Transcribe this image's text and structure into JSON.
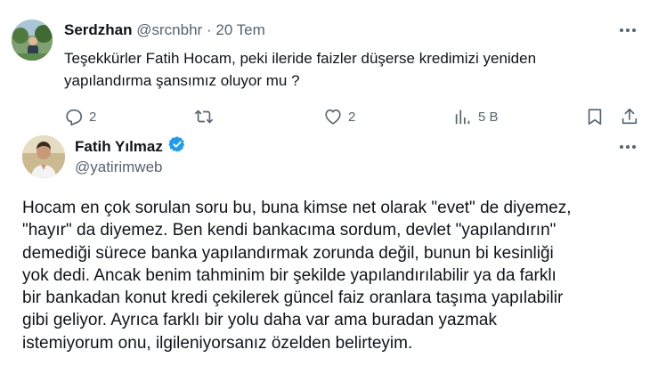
{
  "reply_tweet": {
    "author_name": "Serdzhan",
    "handle": "@srcnbhr",
    "separator": "·",
    "date": "20 Tem",
    "text_lines": [
      "Teşekkürler Fatih Hocam, peki ileride faizler düşerse kredimizi yeniden",
      "yapılandırma şansımız oluyor mu ?"
    ],
    "actions": {
      "reply_count": "2",
      "retweet_count": "",
      "like_count": "2",
      "views_count": "5 B"
    }
  },
  "main_tweet": {
    "author_name": "Fatih Yılmaz",
    "handle": "@yatirimweb",
    "verified": true,
    "text_lines": [
      "Hocam en çok sorulan soru bu, buna kimse net olarak \"evet\" de diyemez,",
      "\"hayır\" da diyemez. Ben kendi bankacıma sordum, devlet \"yapılandırın\"",
      "demediği sürece banka yapılandırmak zorunda değil, bunun bi kesinliği",
      "yok dedi. Ancak benim tahminim bir şekilde yapılandırılabilir ya da farklı",
      "bir bankadan konut kredi çekilerek güncel faiz oranlara taşıma yapılabilir",
      "gibi geliyor. Ayrıca farklı bir yolu daha var ama buradan yazmak",
      "istemiyorum onu, ilgileniyorsanız özelden belirteyim."
    ]
  },
  "colors": {
    "text": "#0f1419",
    "muted": "#536471",
    "verified_blue": "#1d9bf0"
  },
  "icons": [
    "more-icon",
    "reply-icon",
    "retweet-icon",
    "like-icon",
    "views-icon",
    "bookmark-icon",
    "share-icon",
    "verified-badge-icon"
  ]
}
